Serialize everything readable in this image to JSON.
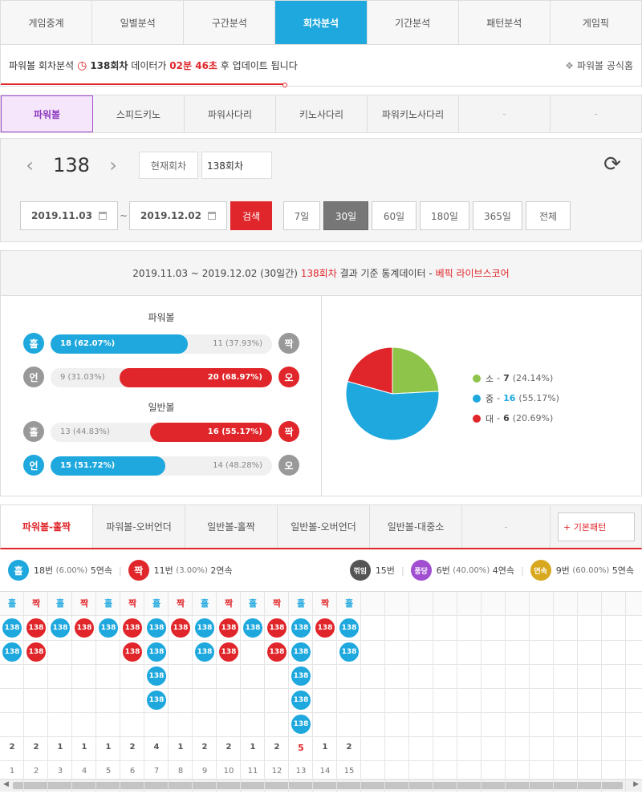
{
  "topnav": [
    "게임중계",
    "일별분석",
    "구간분석",
    "회차분석",
    "기간분석",
    "패턴분석",
    "게임픽"
  ],
  "notice": {
    "prefix": "파워볼 회차분석",
    "round": "138회차",
    "middle": "데이터가",
    "time": "02분 46초",
    "suffix": "후 업데이트 됩니다",
    "right_link": "파워볼 공식홈"
  },
  "gametabs": [
    "파워볼",
    "스피드키노",
    "파워사다리",
    "키노사다리",
    "파워키노사다리",
    "-",
    "-"
  ],
  "round_select": {
    "round": "138",
    "current_btn": "현재회차",
    "round_value": "138회차"
  },
  "date_filter": {
    "from": "2019.11.03",
    "to": "2019.12.02",
    "search": "검색",
    "periods": [
      "7일",
      "30일",
      "60일",
      "180일",
      "365일",
      "전체"
    ]
  },
  "stats": {
    "head_range": "2019.11.03 ~ 2019.12.02 (30일간)",
    "head_round": "138회차",
    "head_mid": "결과 기준 통계데이터 -",
    "head_brand": "베픽 라이브스코어",
    "powerball_title": "파워볼",
    "normal_title": "일반볼",
    "bars": [
      {
        "left_icon": "홀",
        "right_icon": "짝",
        "left_label": "18 (62.07%)",
        "right_label": "11 (37.93%)",
        "left_pct": 62.07,
        "dominant": "left"
      },
      {
        "left_icon": "언",
        "right_icon": "오",
        "left_label": "9 (31.03%)",
        "right_label": "20 (68.97%)",
        "left_pct": 31.03,
        "dominant": "right"
      },
      {
        "left_icon": "홀",
        "right_icon": "짝",
        "left_label": "13 (44.83%)",
        "right_label": "16 (55.17%)",
        "left_pct": 44.83,
        "dominant": "right"
      },
      {
        "left_icon": "언",
        "right_icon": "오",
        "left_label": "15 (51.72%)",
        "right_label": "14 (48.28%)",
        "left_pct": 51.72,
        "dominant": "left"
      }
    ],
    "pie": [
      {
        "name": "소",
        "count": "7",
        "pct": "(24.14%)",
        "value": 24.14,
        "color": "#8fc44b"
      },
      {
        "name": "중",
        "count": "16",
        "pct": "(55.17%)",
        "value": 55.17,
        "color": "#1ea8de"
      },
      {
        "name": "대",
        "count": "6",
        "pct": "(20.69%)",
        "value": 20.69,
        "color": "#e0262a"
      }
    ]
  },
  "pattern_tabs": [
    "파워볼-홀짝",
    "파워볼-오버언더",
    "일반볼-홀짝",
    "일반볼-오버언더",
    "일반볼-대중소",
    "-"
  ],
  "basic_pattern_btn": "+ 기본패턴",
  "summary": {
    "odd_icon": "홀",
    "odd_count": "18번",
    "odd_pct": "(6.00%)",
    "odd_streak": "5연속",
    "even_icon": "짝",
    "even_count": "11번",
    "even_pct": "(3.00%)",
    "even_streak": "2연속",
    "break_icon": "꺾임",
    "break_count": "15번",
    "pong_icon": "퐁당",
    "pong_count": "6번",
    "pong_pct": "(40.00%)",
    "pong_streak": "4연속",
    "run_icon": "연속",
    "run_count": "9번",
    "run_pct": "(60.00%)",
    "run_streak": "5연속"
  },
  "pattern": {
    "ball_label": "138",
    "columns": [
      {
        "type": "홀",
        "count": 2
      },
      {
        "type": "짝",
        "count": 2
      },
      {
        "type": "홀",
        "count": 1
      },
      {
        "type": "짝",
        "count": 1
      },
      {
        "type": "홀",
        "count": 1
      },
      {
        "type": "짝",
        "count": 2
      },
      {
        "type": "홀",
        "count": 4
      },
      {
        "type": "짝",
        "count": 1
      },
      {
        "type": "홀",
        "count": 2
      },
      {
        "type": "짝",
        "count": 2
      },
      {
        "type": "홀",
        "count": 1
      },
      {
        "type": "짝",
        "count": 2
      },
      {
        "type": "홀",
        "count": 5
      },
      {
        "type": "짝",
        "count": 1
      },
      {
        "type": "홀",
        "count": 2
      }
    ],
    "highlight_index": 12
  }
}
